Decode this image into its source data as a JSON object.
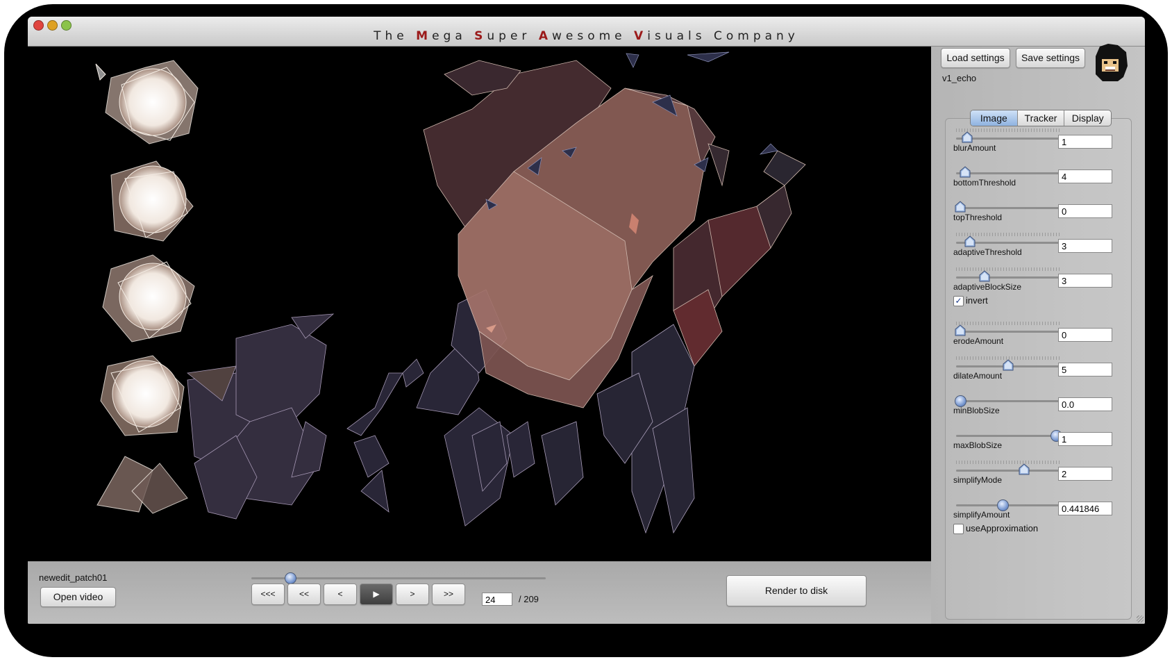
{
  "window": {
    "title_parts": [
      {
        "text": "The ",
        "accent": false
      },
      {
        "text": "M",
        "accent": true
      },
      {
        "text": "ega ",
        "accent": false
      },
      {
        "text": "S",
        "accent": true
      },
      {
        "text": "uper ",
        "accent": false
      },
      {
        "text": "A",
        "accent": true
      },
      {
        "text": "wesome ",
        "accent": false
      },
      {
        "text": "V",
        "accent": true
      },
      {
        "text": "isuals ",
        "accent": false
      },
      {
        "text": "Company",
        "accent": false
      }
    ],
    "accent_color": "#9b1a1a",
    "traffic_lights": [
      "#e0443e",
      "#dea123",
      "#8bc34a"
    ]
  },
  "settings": {
    "load_label": "Load settings",
    "save_label": "Save settings",
    "preset_name": "v1_echo",
    "avatar_icon": "pixel-face-avatar"
  },
  "tabs": [
    {
      "label": "Image",
      "active": true
    },
    {
      "label": "Tracker",
      "active": false
    },
    {
      "label": "Display",
      "active": false
    }
  ],
  "params": [
    {
      "name": "blurAmount",
      "value": "1",
      "knob": "arrow",
      "level": 0.07,
      "ticks": true
    },
    {
      "name": "bottomThreshold",
      "value": "4",
      "knob": "arrow",
      "level": 0.05,
      "ticks": false
    },
    {
      "name": "topThreshold",
      "value": "0",
      "knob": "arrow",
      "level": 0.0,
      "ticks": false
    },
    {
      "name": "adaptiveThreshold",
      "value": "3",
      "knob": "arrow",
      "level": 0.1,
      "ticks": true
    },
    {
      "name": "adaptiveBlockSize",
      "value": "3",
      "knob": "arrow",
      "level": 0.25,
      "ticks": true
    },
    {
      "name": "invert",
      "type": "checkbox",
      "checked": true
    },
    {
      "name": "erodeAmount",
      "value": "0",
      "knob": "arrow",
      "level": 0.0,
      "ticks": true
    },
    {
      "name": "dilateAmount",
      "value": "5",
      "knob": "arrow",
      "level": 0.5,
      "ticks": true
    },
    {
      "name": "minBlobSize",
      "value": "0.0",
      "knob": "round",
      "level": 0.0,
      "ticks": false
    },
    {
      "name": "maxBlobSize",
      "value": "1",
      "knob": "round",
      "level": 1.0,
      "ticks": false
    },
    {
      "name": "simplifyMode",
      "value": "2",
      "knob": "arrow",
      "level": 0.67,
      "ticks": true
    },
    {
      "name": "simplifyAmount",
      "value": "0.441846",
      "knob": "round",
      "level": 0.44,
      "ticks": false
    },
    {
      "name": "useApproximation",
      "type": "checkbox",
      "checked": false
    }
  ],
  "bottom": {
    "file_name": "newedit_patch01",
    "open_video_label": "Open video",
    "transport": [
      "<<<",
      "<<",
      "<",
      "▶",
      ">",
      ">>"
    ],
    "active_transport": 3,
    "timeline_position": 0.13,
    "current_frame": "24",
    "total_frames": "/ 209",
    "render_label": "Render to disk"
  }
}
